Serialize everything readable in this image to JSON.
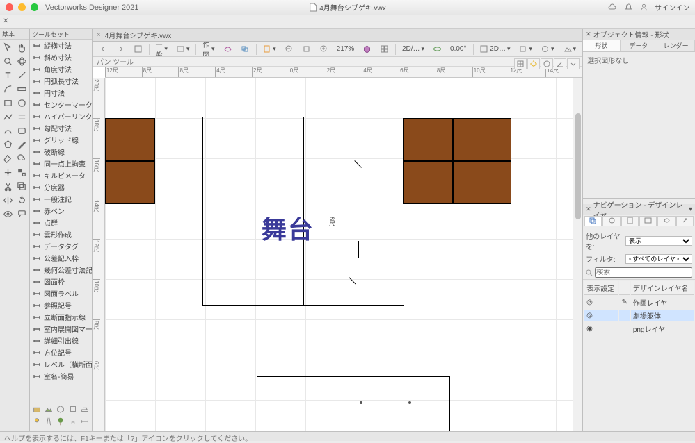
{
  "app_title": "Vectorworks Designer 2021",
  "document_name": "4月舞台シブゲキ.vwx",
  "sign_in": "サインイン",
  "basic_label": "基本",
  "toolset_label": "ツールセット",
  "toolset_items": [
    "縦横寸法",
    "斜め寸法",
    "角度寸法",
    "円弧長寸法",
    "円寸法",
    "センターマーク",
    "ハイパーリンク",
    "勾配寸法",
    "グリッド線",
    "破断線",
    "同一点上拘束",
    "キルビメータ",
    "分度器",
    "一般注記",
    "赤ペン",
    "点群",
    "雲形作成",
    "データタグ",
    "公差記入枠",
    "幾何公差寸法記入",
    "図面枠",
    "図面ラベル",
    "参照記号",
    "立断面指示線",
    "室内展開図マーカー",
    "詳細引出線",
    "方位記号",
    "レベル（横断面）",
    "室名-簡易"
  ],
  "doc_tab_close": "×",
  "mode_bar": "パン ツール",
  "viewbar": {
    "layer": "一般",
    "working": "作図",
    "zoom": "217%",
    "view2d": "2D/…",
    "angle": "0.00°",
    "render": "2D…"
  },
  "ruler_top": [
    "12尺",
    "8尺",
    "8尺",
    "4尺",
    "2尺",
    "0尺",
    "2尺",
    "4尺",
    "6尺",
    "8尺",
    "10尺",
    "12尺",
    "14尺"
  ],
  "ruler_left": [
    "20尺",
    "18尺",
    "16尺",
    "14尺",
    "12尺",
    "10尺",
    "8尺",
    "6尺"
  ],
  "stage_text": "舞台",
  "dim_8r": "8尺",
  "obj_info": {
    "title": "オブジェクト情報 - 形状",
    "tabs": [
      "形状",
      "データ",
      "レンダー"
    ],
    "empty": "選択図形なし"
  },
  "nav": {
    "title": "ナビゲーション - デザインレイヤ",
    "other_layers": "他のレイヤを:",
    "other_val": "表示",
    "filter": "フィルタ:",
    "filter_val": "<すべてのレイヤ>",
    "search_ph": "検索",
    "cols": [
      "表示設定",
      "",
      "デザインレイヤ名"
    ],
    "rows": [
      {
        "vis": "◎",
        "edit": "✎",
        "name": "作画レイヤ",
        "sel": false
      },
      {
        "vis": "◎",
        "edit": "",
        "name": "劇場躯体",
        "sel": true
      },
      {
        "vis": "◉",
        "edit": "",
        "name": "pngレイヤ",
        "sel": false
      }
    ]
  },
  "status": "ヘルプを表示するには、F1キーまたは「?」アイコンをクリックしてください。"
}
